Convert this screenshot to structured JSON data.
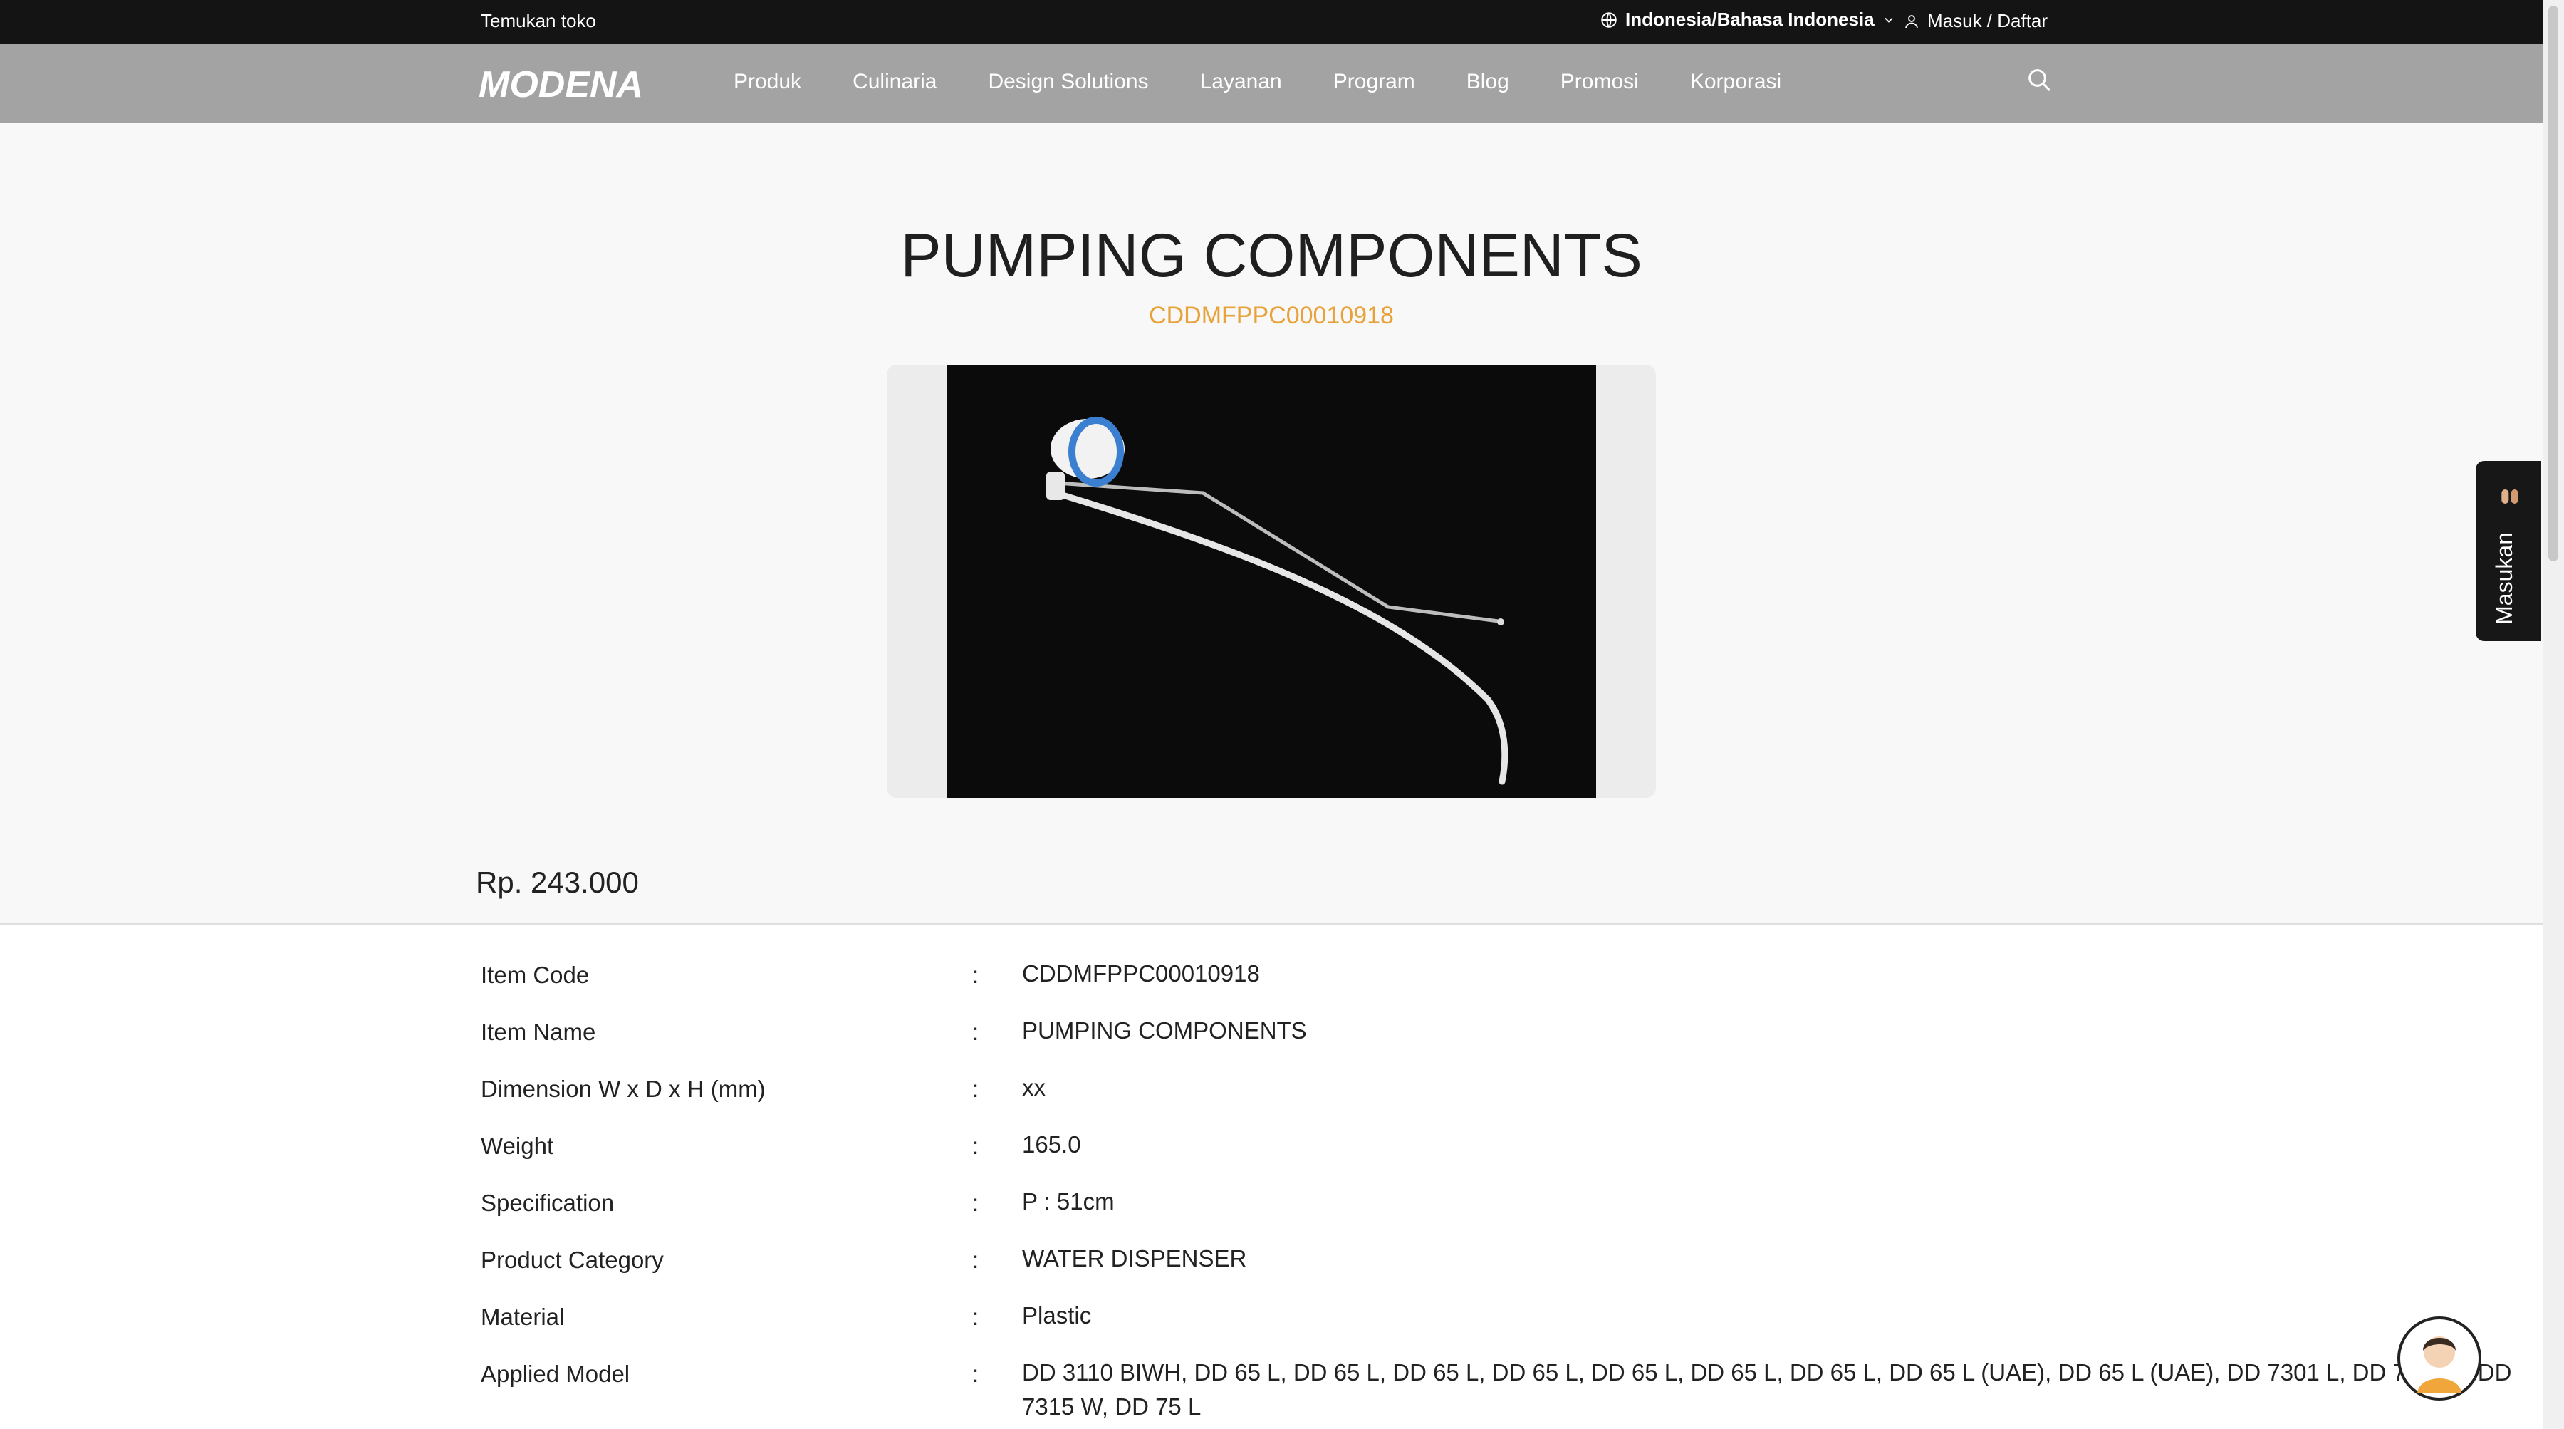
{
  "topbar": {
    "store_link": "Temukan toko",
    "language": "Indonesia/Bahasa Indonesia",
    "login": "Masuk / Daftar"
  },
  "header": {
    "logo_text": "MODENA",
    "nav": [
      "Produk",
      "Culinaria",
      "Design Solutions",
      "Layanan",
      "Program",
      "Blog",
      "Promosi",
      "Korporasi"
    ]
  },
  "product": {
    "title": "PUMPING COMPONENTS",
    "code": "CDDMFPPC00010918",
    "price": "Rp. 243.000"
  },
  "specs": [
    {
      "key": "Item Code",
      "value": "CDDMFPPC00010918"
    },
    {
      "key": "Item Name",
      "value": "PUMPING COMPONENTS"
    },
    {
      "key": "Dimension W x D x H (mm)",
      "value": "xx"
    },
    {
      "key": "Weight",
      "value": "165.0"
    },
    {
      "key": "Specification",
      "value": "P : 51cm"
    },
    {
      "key": "Product Category",
      "value": "WATER DISPENSER"
    },
    {
      "key": "Material",
      "value": "Plastic"
    },
    {
      "key": "Applied Model",
      "value": "DD 3110 BIWH, DD 65 L, DD 65 L, DD 65 L, DD 65 L, DD 65 L, DD 65 L, DD 65 L, DD 65 L (UAE), DD 65 L (UAE), DD 7301 L, DD 7315 L, DD 7315 W, DD 75 L"
    }
  ],
  "spec_separator": ":",
  "feedback": {
    "label": "Masukan"
  },
  "icons": {
    "globe": "globe-icon",
    "chevron": "chevron-down-icon",
    "user": "user-icon",
    "search": "search-icon",
    "chat": "chatbot-avatar-icon"
  },
  "colors": {
    "topbar": "#141414",
    "navbar": "#a3a3a3",
    "accent": "#e8a23a"
  }
}
